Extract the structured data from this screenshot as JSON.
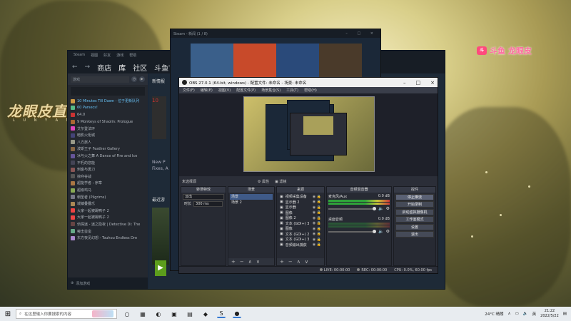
{
  "watermark": {
    "left_title": "龙眼皮直播",
    "left_sub": "L U N Y A N P I",
    "right_logo": "斗",
    "right_text": "斗鱼 龙眼皮"
  },
  "steam": {
    "top_menu": [
      "Steam",
      "视图",
      "好友",
      "游戏",
      "帮助"
    ],
    "nav": [
      "商店",
      "库",
      "社区",
      "斗鱼TV-龙眼"
    ],
    "filter": "游戏",
    "games": [
      {
        "name": "10 Minutes Till Dawn - 位于更新队列",
        "color": "#c94",
        "running": true
      },
      {
        "name": "60 Parsecs!",
        "color": "#5b8",
        "running": true
      },
      {
        "name": "64.0",
        "color": "#c33",
        "running": false
      },
      {
        "name": "9 Monkeys of Shaolin: Prologue",
        "color": "#a63",
        "running": false
      },
      {
        "name": "艾尔登法环",
        "color": "#d4b",
        "running": false
      },
      {
        "name": "暗影火炬城",
        "color": "#447",
        "running": false
      },
      {
        "name": "八方旅人",
        "color": "#998",
        "running": false
      },
      {
        "name": "波斯王子 Feather Gallery",
        "color": "#864",
        "running": false
      },
      {
        "name": "冰与火之舞 A Dance of Fire and Ice",
        "color": "#659",
        "running": false
      },
      {
        "name": "不朽的您能",
        "color": "#445",
        "running": false
      },
      {
        "name": "刺客与勇刀",
        "color": "#855",
        "running": false
      },
      {
        "name": "掠夺谷战",
        "color": "#555",
        "running": false
      },
      {
        "name": "超能学者 : 序章",
        "color": "#a74",
        "running": false
      },
      {
        "name": "超级鸡马",
        "color": "#8a5",
        "running": false
      },
      {
        "name": "朝圣者 (Pilgrims)",
        "color": "#778",
        "running": false
      },
      {
        "name": "城镇叠叠乐",
        "color": "#a85",
        "running": false
      },
      {
        "name": "大家一起被踢鸭子 2",
        "color": "#e44",
        "running": false
      },
      {
        "name": "大家一起被踢鸭子 2",
        "color": "#e44",
        "running": false
      },
      {
        "name": "侦探迷 - 迷之隐夜 | Detective Di: The",
        "color": "#644",
        "running": false
      },
      {
        "name": "嘟击蛮蛮",
        "color": "#6a8",
        "running": false
      },
      {
        "name": "东方夜见幻想 - Touhou Endless Dre",
        "color": "#a8c",
        "running": false
      }
    ],
    "footer": "添加游戏",
    "main": {
      "news_header": "新情报",
      "news_badge": "10",
      "news_text_1": "New P",
      "news_text_2": "Fixes, A",
      "recent_header": "最近游",
      "play_icon": "▶"
    }
  },
  "newswin": {
    "title": "Steam - 新闻 (1 / 8)",
    "controls": "– □ ×",
    "banner_colors": [
      "#3a5f8a",
      "#c84a2a",
      "#2a4a7a",
      "#4a3a2a"
    ]
  },
  "obs": {
    "title": "OBS 27.0.1 (64-bit, windows) - 配置文件: 未命名 - 场景: 未命名",
    "controls": [
      "–",
      "□",
      "×"
    ],
    "menu": [
      "文件(F)",
      "编辑(E)",
      "视图(V)",
      "配置文件(P)",
      "场景集合(S)",
      "工具(T)",
      "帮助(H)"
    ],
    "mixbar_label": "未选择源",
    "mixbar_buttons": [
      "⚙ 属性",
      "▣ 滤镜"
    ],
    "docks": {
      "transitions": {
        "header": "转场特效",
        "type": "淡出",
        "duration_label": "时长",
        "duration": "300 ms"
      },
      "scenes": {
        "header": "场景",
        "items": [
          "场景",
          "场景 2"
        ]
      },
      "sources": {
        "header": "来源",
        "items": [
          "视频采集设备",
          "显示器 2",
          "显示器",
          "图像",
          "图像 2",
          "文本 (GDI+) 3",
          "图像",
          "文本 (GDI+) 2",
          "文本 (GDI+) 3",
          "音频输出捕获"
        ]
      },
      "mixer": {
        "header": "音频混音器",
        "channels": [
          {
            "name": "麦克风/Aux",
            "db": "0.0 dB"
          },
          {
            "name": "桌面音频",
            "db": "0.0 dB"
          }
        ]
      },
      "controls": {
        "header": "控件",
        "buttons": [
          "停止推流",
          "开始录制",
          "启动虚拟摄像机",
          "工作室模式",
          "设置",
          "退出"
        ]
      }
    },
    "footer_buttons": [
      "+",
      "−",
      "∧",
      "∨"
    ],
    "status": {
      "live": "LIVE: 00:00:00",
      "rec": "REC: 00:00:00",
      "cpu": "CPU: 0.0%, 60.00 fps"
    }
  },
  "taskbar": {
    "search_placeholder": "在这里输入你要搜索的内容",
    "icons": [
      "○",
      "▦",
      "◐",
      "▣",
      "▤",
      "◆",
      "S",
      "●"
    ],
    "temp": "24°C 晴朗",
    "lang": "英",
    "time": "21:22",
    "date": "2022/5/22"
  }
}
